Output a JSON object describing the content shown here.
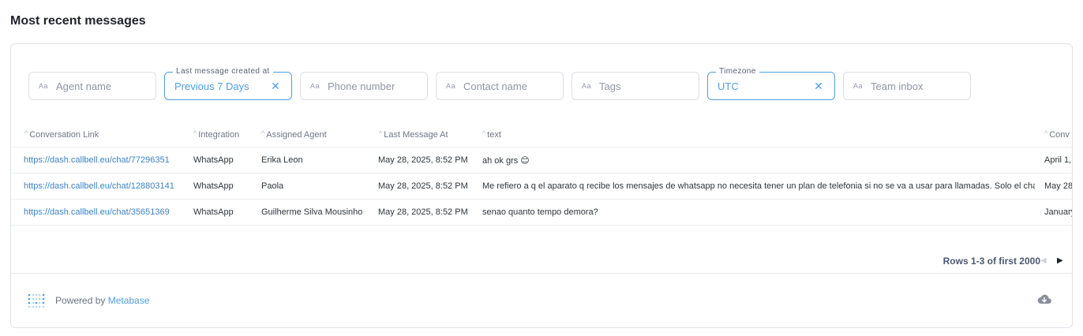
{
  "page": {
    "title": "Most recent messages"
  },
  "filters": [
    {
      "placeholder": "Agent name",
      "active": false,
      "label": "",
      "value": ""
    },
    {
      "placeholder": "",
      "active": true,
      "label": "Last message created at",
      "value": "Previous 7 Days"
    },
    {
      "placeholder": "Phone number",
      "active": false,
      "label": "",
      "value": ""
    },
    {
      "placeholder": "Contact name",
      "active": false,
      "label": "",
      "value": ""
    },
    {
      "placeholder": "Tags",
      "active": false,
      "label": "",
      "value": ""
    },
    {
      "placeholder": "",
      "active": true,
      "label": "Timezone",
      "value": "UTC"
    },
    {
      "placeholder": "Team inbox",
      "active": false,
      "label": "",
      "value": ""
    }
  ],
  "filter_prefix": "Aa",
  "table": {
    "columns": [
      "Conversation Link",
      "Integration",
      "Assigned Agent",
      "Last Message At",
      "text",
      "Conv"
    ],
    "rows": [
      [
        "https://dash.callbell.eu/chat/77296351",
        "WhatsApp",
        "Erika Leon",
        "May 28, 2025, 8:52 PM",
        "ah ok grs 😊",
        "April 1,"
      ],
      [
        "https://dash.callbell.eu/chat/128803141",
        "WhatsApp",
        "Paola",
        "May 28, 2025, 8:52 PM",
        "Me refiero a q el aparato q recibe los mensajes de whatsapp no necesita tener un plan de telefonia si no se va a usar para llamadas. Solo el chatbot",
        "May 28"
      ],
      [
        "https://dash.callbell.eu/chat/35651369",
        "WhatsApp",
        "Guilherme Silva Mousinho",
        "May 28, 2025, 8:52 PM",
        "senao quanto tempo demora?",
        "January"
      ]
    ]
  },
  "pagination": {
    "label": "Rows 1-3 of first 2000"
  },
  "footer": {
    "powered_by": "Powered by ",
    "brand": "Metabase"
  },
  "icons": {
    "clear": "close-icon",
    "prev": "chevron-left-icon",
    "next": "chevron-right-icon",
    "download": "cloud-download-icon",
    "logo": "metabase-logo-icon"
  },
  "colors": {
    "accent": "#509ee3",
    "link": "#3a83c5"
  }
}
